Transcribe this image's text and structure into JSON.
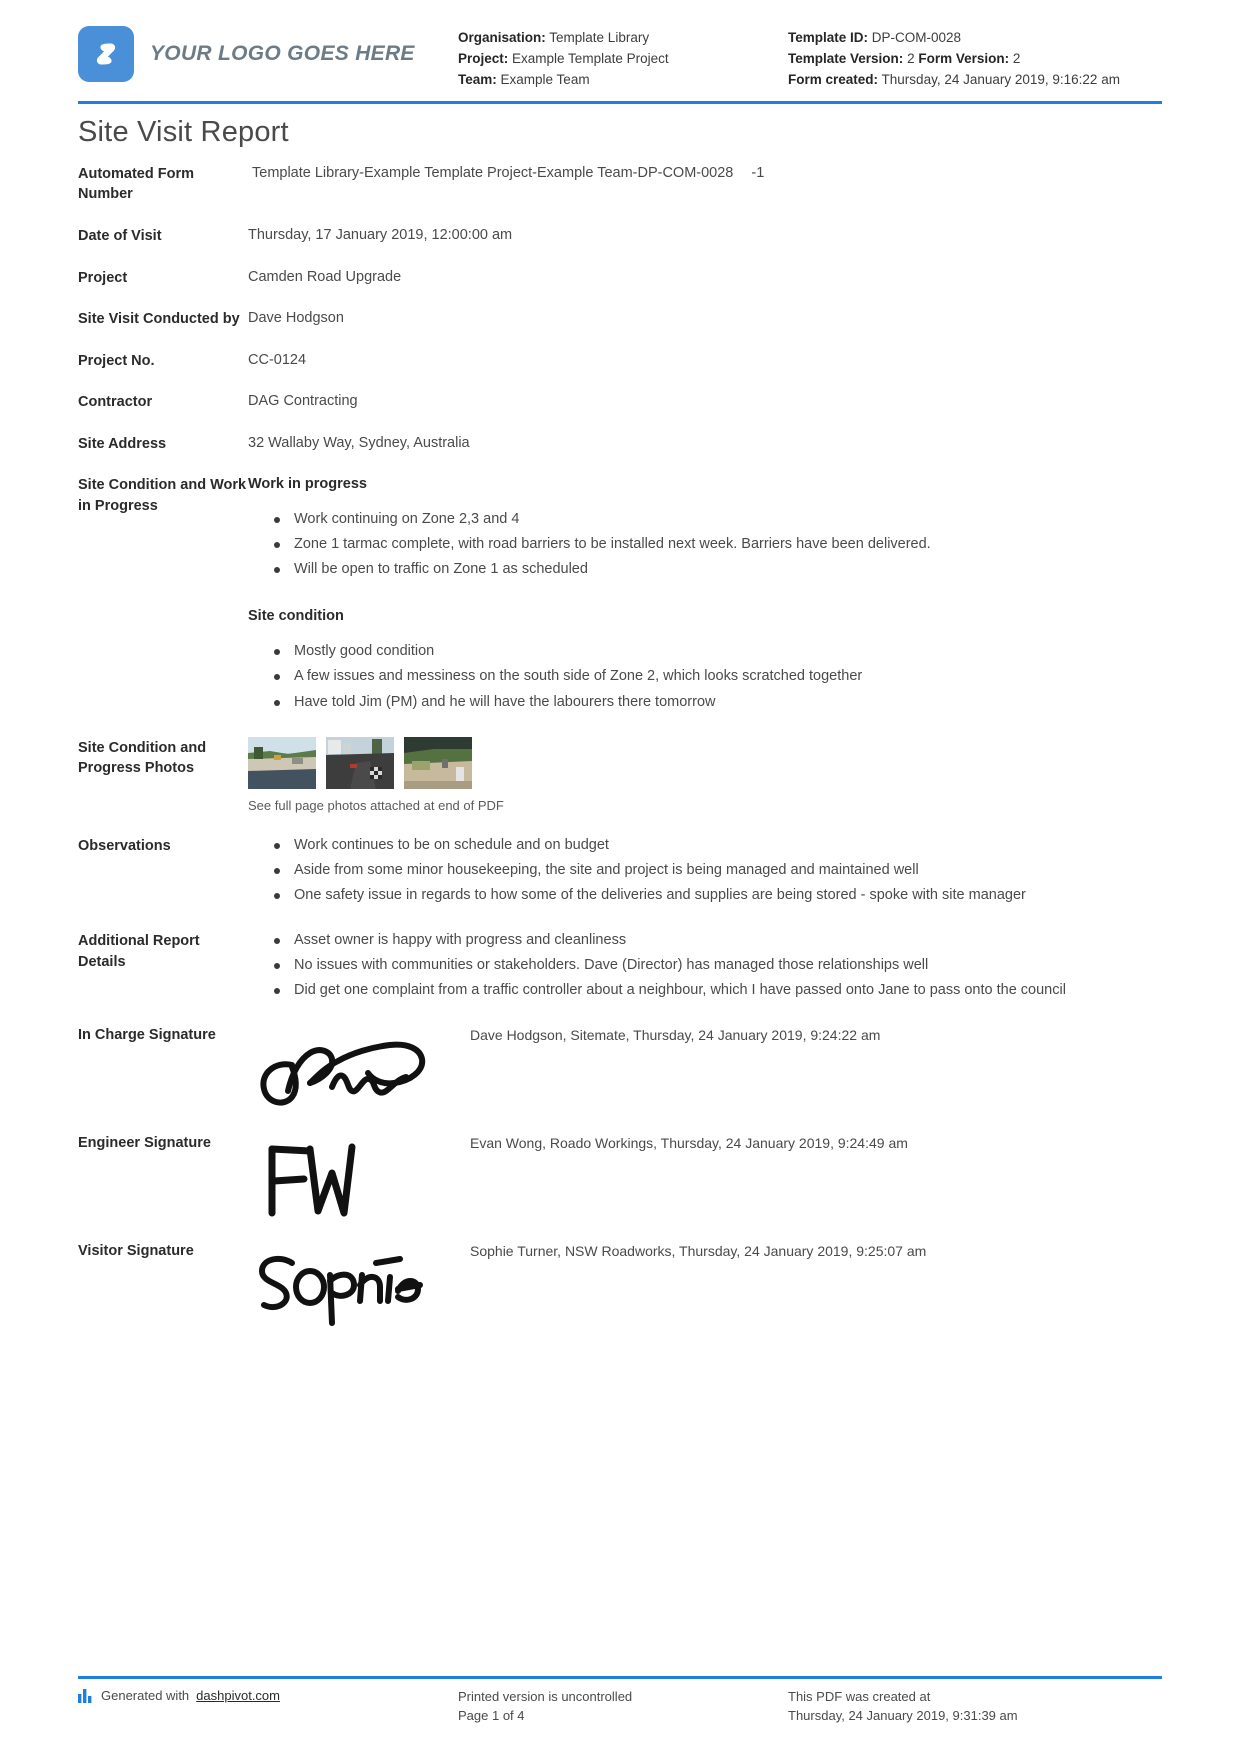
{
  "header": {
    "logo_text": "YOUR LOGO GOES HERE",
    "logo_icon": "dashpivot-logo-icon",
    "accent_color": "#1f7fe0",
    "logo_bg_color": "#4a90d9",
    "left_meta": {
      "organisation_label": "Organisation:",
      "organisation_value": "Template Library",
      "project_label": "Project:",
      "project_value": "Example Template Project",
      "team_label": "Team:",
      "team_value": "Example Team"
    },
    "right_meta": {
      "template_id_label": "Template ID:",
      "template_id_value": "DP-COM-0028",
      "template_version_label": "Template Version:",
      "template_version_value": "2",
      "form_version_label": "Form Version:",
      "form_version_value": "2",
      "form_created_label": "Form created:",
      "form_created_value": "Thursday, 24 January 2019, 9:16:22 am"
    }
  },
  "title": "Site Visit Report",
  "fields": {
    "automated_form_number": {
      "label": "Automated Form Number",
      "value": "Template Library-Example Template Project-Example Team-DP-COM-0028",
      "suffix": "-1"
    },
    "date_of_visit": {
      "label": "Date of Visit",
      "value": "Thursday, 17 January 2019, 12:00:00 am"
    },
    "project": {
      "label": "Project",
      "value": "Camden Road Upgrade"
    },
    "conducted_by": {
      "label": "Site Visit Conducted by",
      "value": "Dave Hodgson"
    },
    "project_no": {
      "label": "Project No.",
      "value": "CC-0124"
    },
    "contractor": {
      "label": "Contractor",
      "value": "DAG Contracting"
    },
    "site_address": {
      "label": "Site Address",
      "value": "32 Wallaby Way, Sydney, Australia"
    },
    "site_condition_work": {
      "label": "Site Condition and Work in Progress",
      "heading_1": "Work in progress",
      "bullets_1": [
        "Work continuing on Zone 2,3 and 4",
        "Zone 1 tarmac complete, with road barriers to be installed next week. Barriers have been delivered.",
        "Will be open to traffic on Zone 1 as scheduled"
      ],
      "heading_2": "Site condition",
      "bullets_2": [
        "Mostly good condition",
        "A few issues and messiness on the south side of Zone 2, which looks scratched together",
        "Have told Jim (PM) and he will have the labourers there tomorrow"
      ]
    },
    "photos": {
      "label": "Site Condition and Progress Photos",
      "caption": "See full page photos attached at end of PDF",
      "items": [
        {
          "name": "site-photo-1"
        },
        {
          "name": "site-photo-2"
        },
        {
          "name": "site-photo-3"
        }
      ]
    },
    "observations": {
      "label": "Observations",
      "bullets": [
        "Work continues to be on schedule and on budget",
        "Aside from some minor housekeeping, the site and project is being managed and maintained well",
        "One safety issue in regards to how some of the deliveries and supplies are being stored - spoke with site manager"
      ]
    },
    "additional_details": {
      "label": "Additional Report Details",
      "bullets": [
        "Asset owner is happy with progress and cleanliness",
        "No issues with communities or stakeholders. Dave (Director) has managed those relationships well",
        "Did get one complaint from a traffic controller about a neighbour, which I have passed onto Jane to pass onto the council"
      ]
    }
  },
  "signatures": [
    {
      "label": "In Charge Signature",
      "signature_name": "signature-dave-hodgson",
      "meta": "Dave Hodgson, Sitemate, Thursday, 24 January 2019, 9:24:22 am"
    },
    {
      "label": "Engineer Signature",
      "signature_name": "signature-evan-wong",
      "meta": "Evan Wong, Roado Workings, Thursday, 24 January 2019, 9:24:49 am"
    },
    {
      "label": "Visitor Signature",
      "signature_name": "signature-sophie-turner",
      "meta": "Sophie Turner, NSW Roadworks, Thursday, 24 January 2019, 9:25:07 am"
    }
  ],
  "footer": {
    "generated_prefix": "Generated with",
    "generated_link": "dashpivot.com",
    "printed_notice": "Printed version is uncontrolled",
    "page_number": "Page 1 of 4",
    "created_label": "This PDF was created at",
    "created_value": "Thursday, 24 January 2019, 9:31:39 am"
  }
}
